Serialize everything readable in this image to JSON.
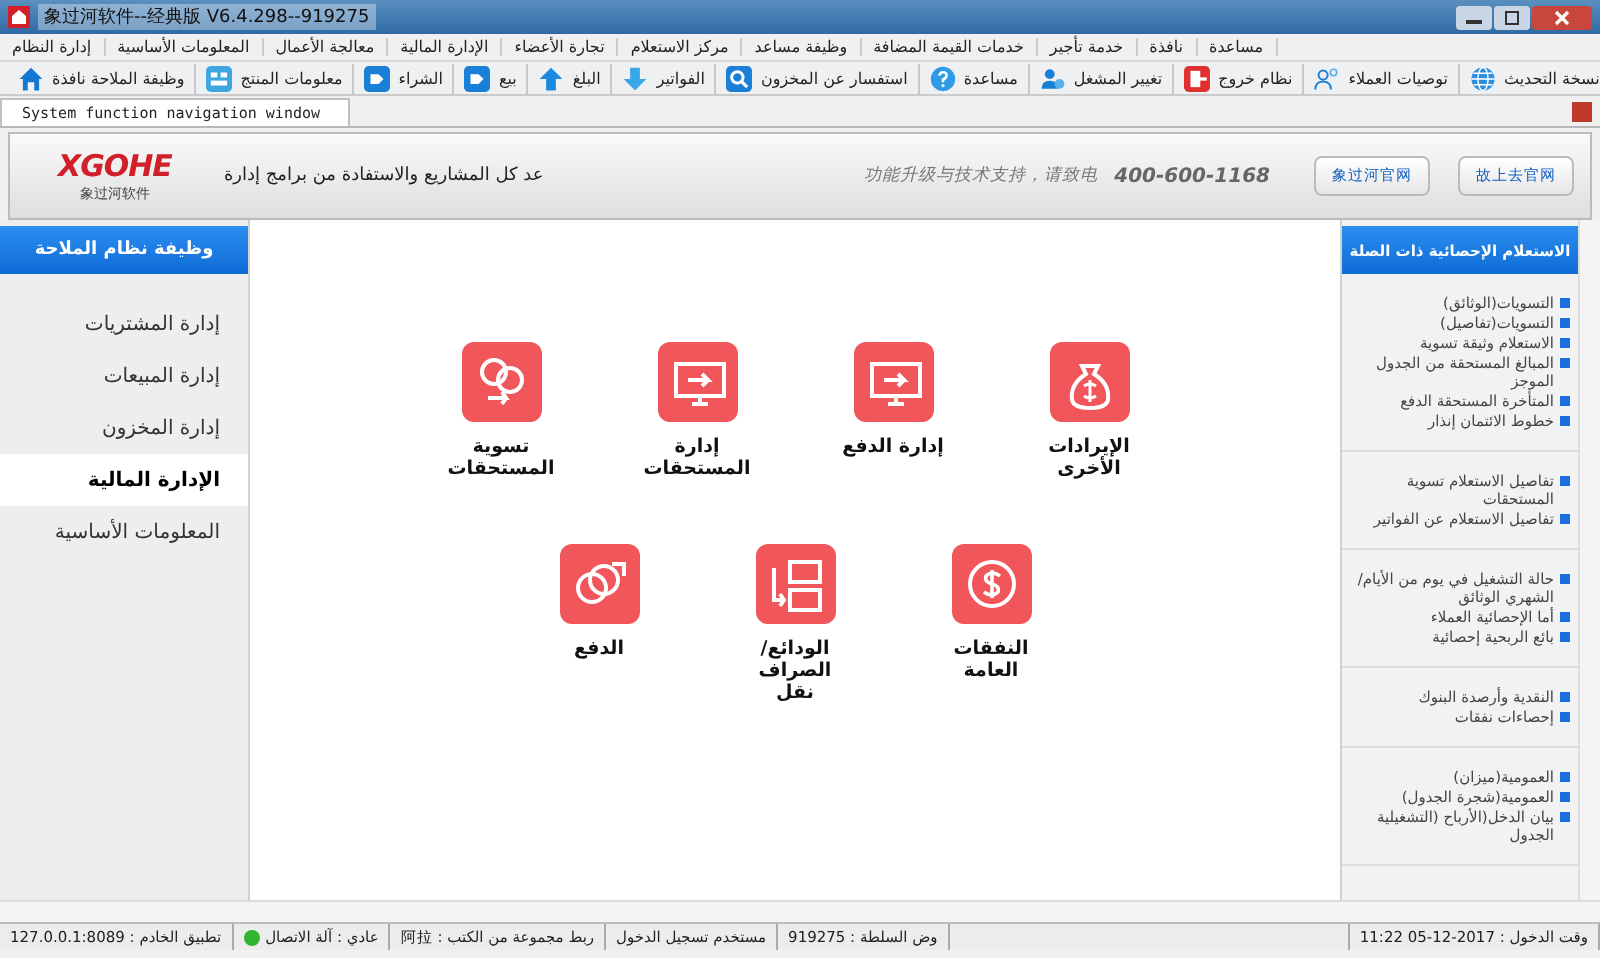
{
  "window": {
    "title": "象过河软件--经典版 V6.4.298--919275"
  },
  "menu": [
    "مساعدة",
    "نافذة",
    "خدمة تأجير",
    "خدمات القيمة المضافة",
    "وظيفة مساعد",
    "مركز الاستعلام",
    "تجارة الأعضاء",
    "الإدارة المالية",
    "معالجة الأعمال",
    "المعلومات الأساسية",
    "إدارة النظام"
  ],
  "toolbar": [
    {
      "label": "نسخة التحديث",
      "kind": "globe"
    },
    {
      "label": "توصيات العملاء",
      "kind": "people"
    },
    {
      "label": "نظام خروج",
      "kind": "exit"
    },
    {
      "label": "تغيير المشغل",
      "kind": "user"
    },
    {
      "label": "مساعدة",
      "kind": "help"
    },
    {
      "label": "استفسار عن المخزون",
      "kind": "search"
    },
    {
      "label": "الفواتير",
      "kind": "down"
    },
    {
      "label": "البلغ",
      "kind": "up"
    },
    {
      "label": "بيع",
      "kind": "tag"
    },
    {
      "label": "الشراء",
      "kind": "tag"
    },
    {
      "label": "معلومات المنتج",
      "kind": "product"
    },
    {
      "label": "وظيفة الملاحة نافذة",
      "kind": "home"
    }
  ],
  "tabs": [
    {
      "label": "System function navigation window",
      "selected": true
    }
  ],
  "header": {
    "logo": "XGOHE",
    "logo_sub": "象过河软件",
    "slogan": "عد كل المشاريع والاستفادة من برامج إدارة",
    "support": "功能升级与技术支持，请致电",
    "phone": "400-600-1168",
    "buttons": [
      "故上去官网",
      "象过河官网"
    ]
  },
  "sidebar": {
    "title": "وظيفة نظام الملاحة",
    "items": [
      {
        "label": "إدارة المشتريات",
        "selected": false
      },
      {
        "label": "إدارة المبيعات",
        "selected": false
      },
      {
        "label": "إدارة المخزون",
        "selected": false
      },
      {
        "label": "الإدارة المالية",
        "selected": true
      },
      {
        "label": "المعلومات الأساسية",
        "selected": false
      }
    ]
  },
  "functions": [
    [
      {
        "label": "الإيرادات الأخرى",
        "kind": "bag"
      },
      {
        "label": "إدارة الدفع",
        "kind": "monitor"
      },
      {
        "label": "إدارة المستحقات",
        "kind": "monitor"
      },
      {
        "label": "تسوية المستحقات",
        "kind": "swap"
      }
    ],
    [
      {
        "label": "النفقات العامة",
        "kind": "dollar"
      },
      {
        "label": "الودائع/الصراف نقل",
        "kind": "transfer"
      },
      {
        "label": "الدفع",
        "kind": "coins"
      }
    ]
  ],
  "related": {
    "title": "الاستعلام الإحصائية ذات الصلة",
    "groups": [
      [
        "(التسويات(الوثائق",
        "(التسويات(تفاصيل",
        "الاستعلام وثيقة تسوية",
        "المبالغ المستحقة من الجدول الموجز",
        "المتأخرة المستحقة الدفع",
        "خطوط الائتمان إنذار"
      ],
      [
        "تفاصيل الاستعلام تسوية المستحقات",
        "تفاصيل الاستعلام عن الفواتير"
      ],
      [
        "حالة التشغيل في يوم من الأيام/الشهري الوثائق",
        "أما الإحصائية العملاء",
        "بائع الربحية إحصائية"
      ],
      [
        "النقدية وأرصدة البنوك",
        "إحصاءات نفقات"
      ],
      [
        "(العمومية(ميزان",
        "(العمومية(شجرة الجدول",
        "بيان الدخل(الأرباح (التشغيلية الجدول"
      ]
    ]
  },
  "status_bar": [
    {
      "text": "11:22 05-12-2017 : وقت الدخول",
      "kind": "text"
    },
    {
      "kind": "blank"
    },
    {
      "text": "919275 : وض السلطة",
      "kind": "text"
    },
    {
      "text": "مستخدم تسجيل الدخول",
      "kind": "text"
    },
    {
      "text": "阿拉 : ربط مجموعة من الكتب",
      "kind": "text"
    },
    {
      "text": "عادي : آلة الاتصال",
      "kind": "online"
    },
    {
      "text": "127.0.0.1:8089 : تطبيق الخادم",
      "kind": "text"
    }
  ]
}
